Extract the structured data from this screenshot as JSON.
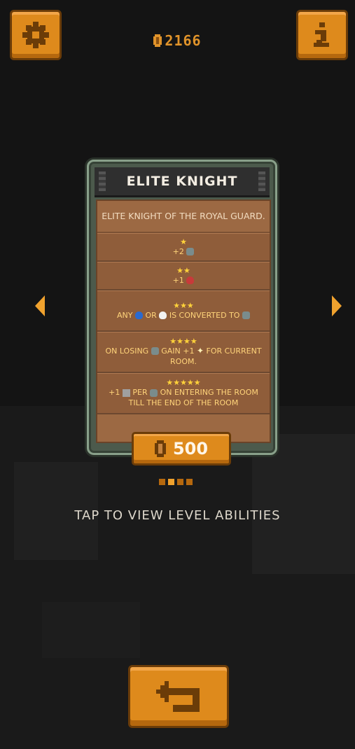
{
  "header": {
    "coins": "2166",
    "settings_icon": "gear-icon",
    "info_icon": "info-icon"
  },
  "card": {
    "title": "ELITE KNIGHT",
    "description": "ELITE KNIGHT OF THE ROYAL GUARD.",
    "levels": [
      {
        "stars": "★",
        "parts": [
          "+2",
          "skull"
        ]
      },
      {
        "stars": "★★",
        "parts": [
          "+1",
          "heart"
        ]
      },
      {
        "stars": "★★★",
        "parts": [
          "ANY",
          "blueheart",
          "OR",
          "whiteheart",
          "IS CONVERTED TO",
          "skull"
        ]
      },
      {
        "stars": "★★★★",
        "parts": [
          "ON LOSING",
          "skull",
          "GAIN +1",
          "spark",
          "FOR CURRENT ROOM."
        ]
      },
      {
        "stars": "★★★★★",
        "parts": [
          "+1",
          "boot",
          "PER",
          "skull",
          "ON ENTERING THE ROOM TILL THE END OF THE ROOM"
        ]
      }
    ],
    "price": "500"
  },
  "pager": {
    "count": 4,
    "active": 1
  },
  "hint": "TAP TO VIEW LEVEL ABILITIES",
  "colors": {
    "accent": "#de8a1c",
    "card_body": "#9c6943",
    "coin": "#e0932a"
  }
}
